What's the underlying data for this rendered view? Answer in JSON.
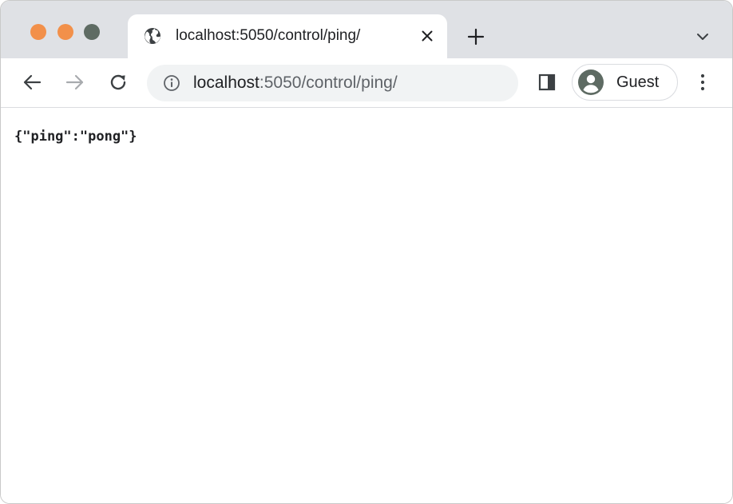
{
  "window": {
    "traffic_lights": [
      "close",
      "minimize",
      "maximize"
    ]
  },
  "tabs": [
    {
      "title": "localhost:5050/control/ping/",
      "icon": "globe-icon",
      "active": true
    }
  ],
  "toolbar": {
    "url_host": "localhost",
    "url_path": ":5050/control/ping/",
    "profile_label": "Guest"
  },
  "page": {
    "body_text": "{\"ping\":\"pong\"}"
  },
  "colors": {
    "titlebar_bg": "#dfe1e5",
    "omnibox_bg": "#f1f3f4",
    "traffic_orange": "#f2904a",
    "traffic_gray": "#5e6b63",
    "icon_dark": "#3c4043"
  }
}
